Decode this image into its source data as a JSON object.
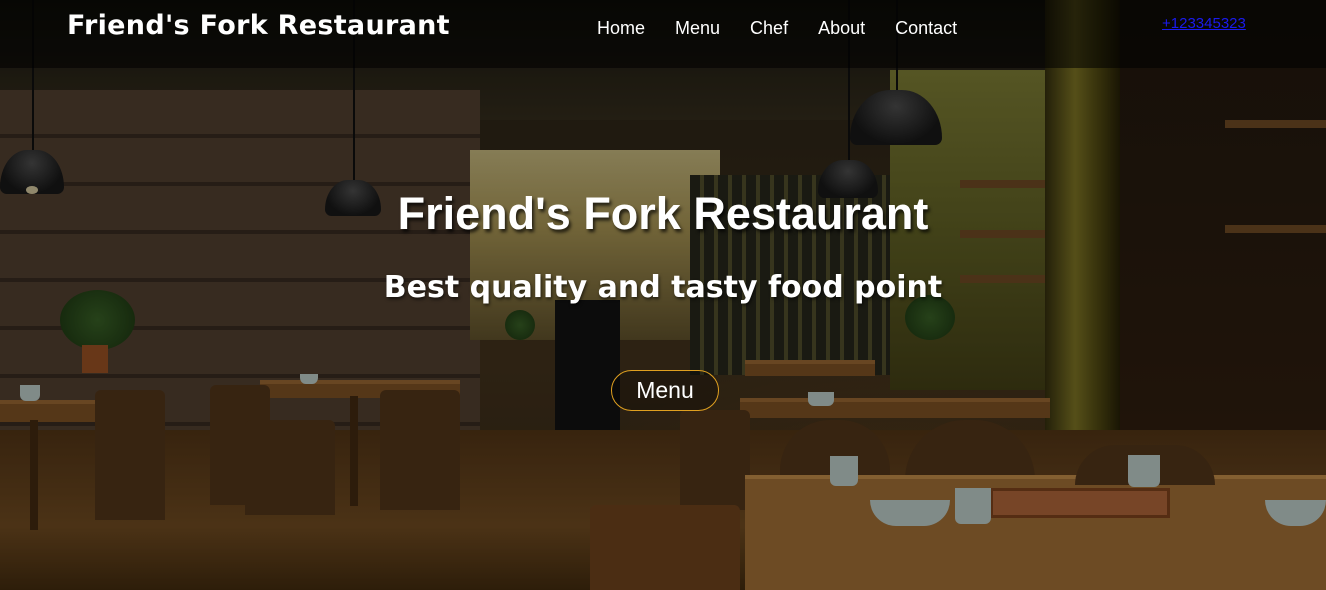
{
  "header": {
    "brand": "Friend's Fork Restaurant",
    "nav": [
      "Home",
      "Menu",
      "Chef",
      "About",
      "Contact"
    ],
    "phone": "+123345323"
  },
  "hero": {
    "title": "Friend's Fork Restaurant",
    "subtitle": "Best quality and tasty food point",
    "button_label": "Menu",
    "button_border_color": "#e0a020",
    "background": "restaurant-interior-photo"
  }
}
